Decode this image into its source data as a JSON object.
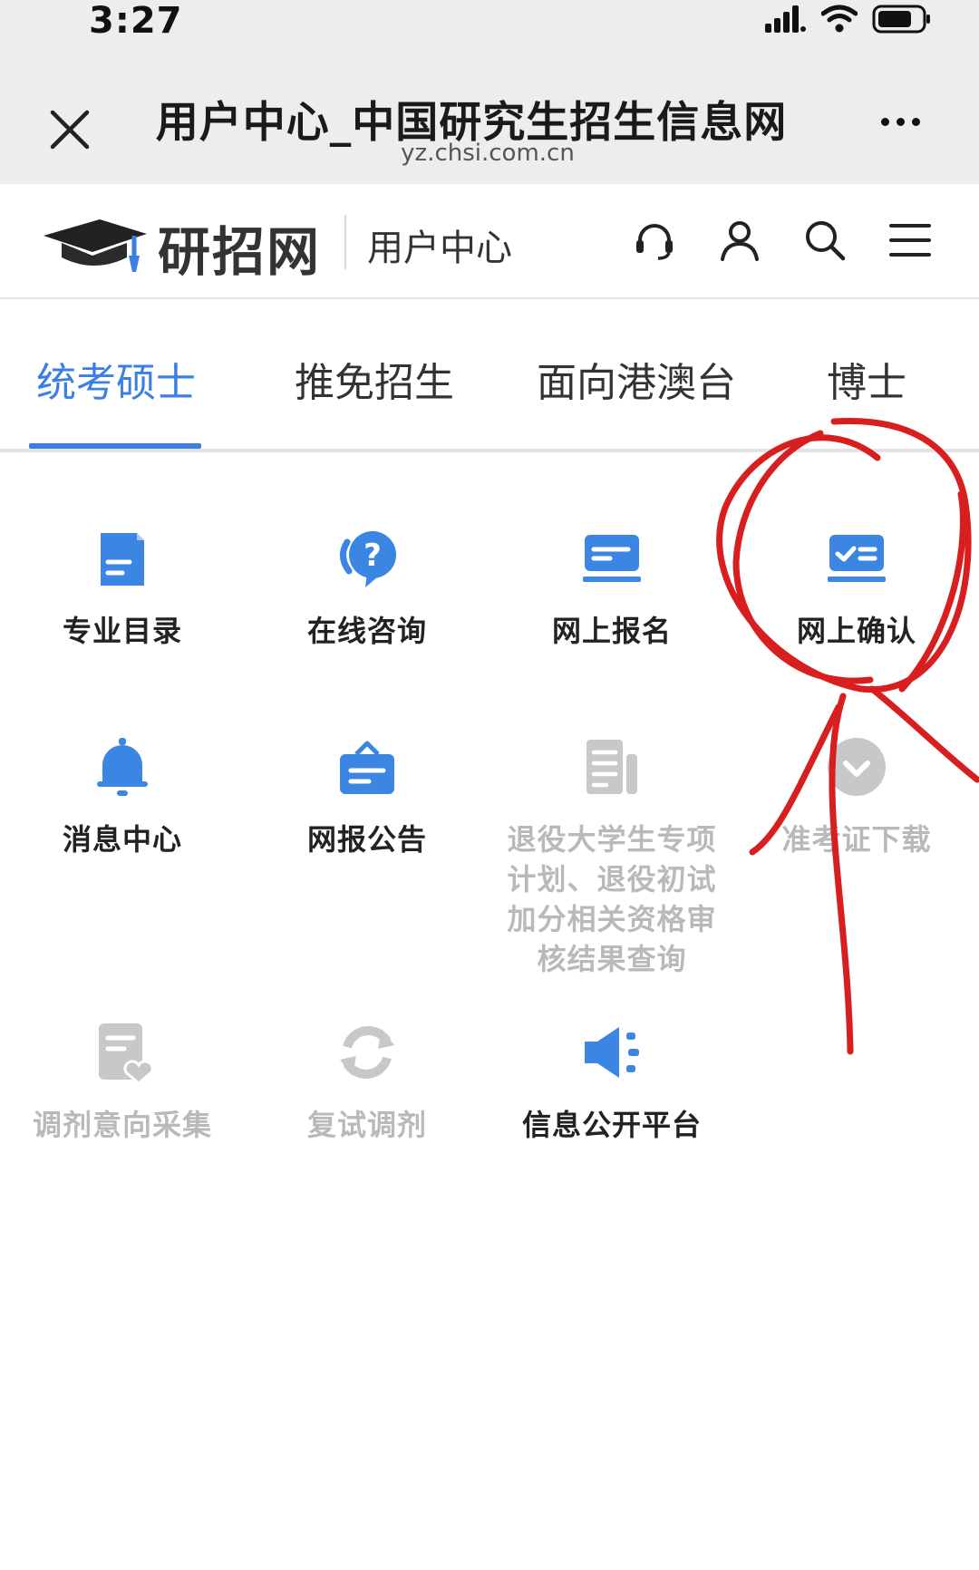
{
  "status_bar": {
    "time": "3:27"
  },
  "browser": {
    "title": "用户中心_中国研究生招生信息网",
    "url": "yz.chsi.com.cn"
  },
  "site_header": {
    "logo_text": "研招网",
    "subtitle": "用户中心"
  },
  "tabs": [
    {
      "label": "统考硕士",
      "active": true
    },
    {
      "label": "推免招生",
      "active": false
    },
    {
      "label": "面向港澳台",
      "active": false
    },
    {
      "label": "博士",
      "active": false
    }
  ],
  "grid": [
    {
      "label": "专业目录",
      "icon": "document-icon",
      "enabled": true
    },
    {
      "label": "在线咨询",
      "icon": "question-chat-icon",
      "enabled": true
    },
    {
      "label": "网上报名",
      "icon": "signup-card-icon",
      "enabled": true
    },
    {
      "label": "网上确认",
      "icon": "confirm-card-icon",
      "enabled": true
    },
    {
      "label": "消息中心",
      "icon": "bell-icon",
      "enabled": true
    },
    {
      "label": "网报公告",
      "icon": "announcement-icon",
      "enabled": true
    },
    {
      "label": "退役大学生专项计划、退役初试加分相关资格审核结果查询",
      "icon": "file-list-icon",
      "enabled": false
    },
    {
      "label": "准考证下载",
      "icon": "download-icon",
      "enabled": false
    },
    {
      "label": "调剂意向采集",
      "icon": "heart-form-icon",
      "enabled": false
    },
    {
      "label": "复试调剂",
      "icon": "refresh-icon",
      "enabled": false
    },
    {
      "label": "信息公开平台",
      "icon": "speaker-icon",
      "enabled": true
    }
  ],
  "colors": {
    "accent": "#3a7ee6",
    "icon_blue": "#3b86e3",
    "disabled": "#c8c8c8",
    "annotation_red": "#d81e1e"
  }
}
